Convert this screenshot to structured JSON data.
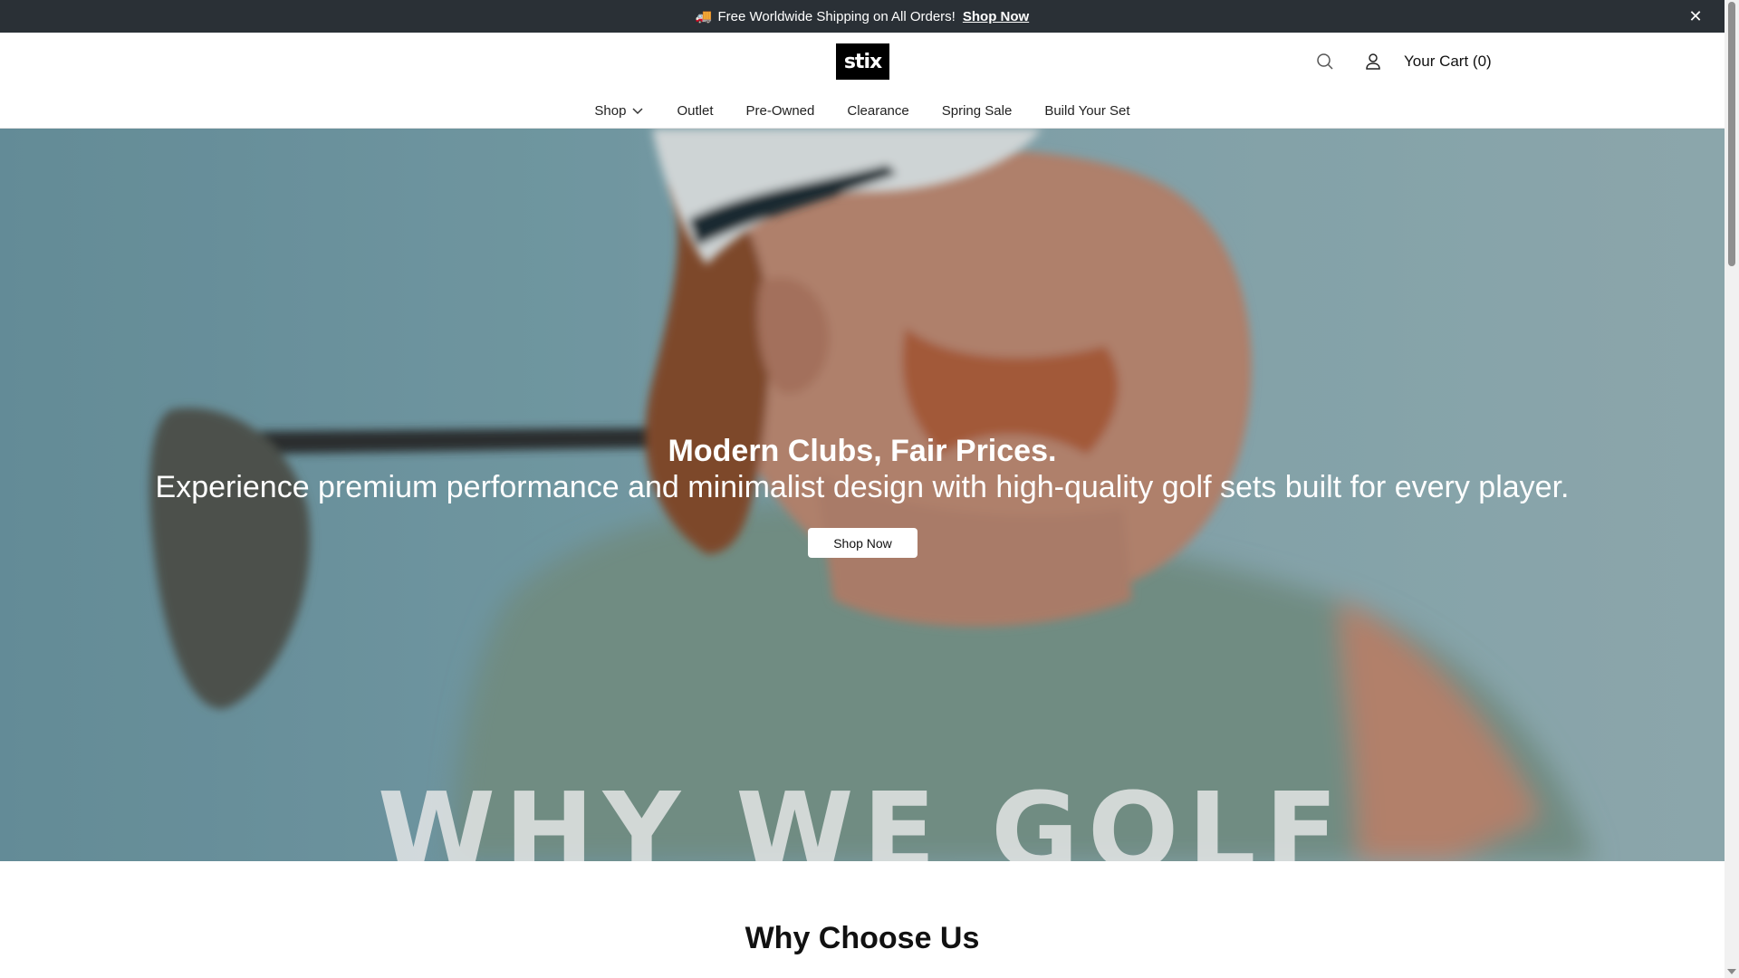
{
  "announcement": {
    "icon": "truck-icon",
    "text": "Free Worldwide Shipping on All Orders!",
    "link": "Shop Now",
    "close_label": "✕"
  },
  "header": {
    "logo_text": "stix",
    "cart_label": "Your Cart (0)",
    "icons": [
      "search-icon",
      "account-icon"
    ]
  },
  "nav": {
    "items": [
      {
        "label": "Shop",
        "has_dropdown": true
      },
      {
        "label": "Outlet"
      },
      {
        "label": "Pre-Owned"
      },
      {
        "label": "Clearance"
      },
      {
        "label": "Spring Sale"
      },
      {
        "label": "Build Your Set"
      }
    ]
  },
  "hero": {
    "title": "Modern Clubs, Fair Prices.",
    "subtitle": "Experience premium performance and minimalist design with high-quality golf sets built for every player.",
    "button_label": "Shop Now",
    "watermark": "WHY WE GOLF"
  },
  "section": {
    "title": "Why Choose Us"
  },
  "colors": {
    "announcement_bg": "#2a3036",
    "hero_tint": "#7ea6b0",
    "logo_bg": "#000000"
  }
}
